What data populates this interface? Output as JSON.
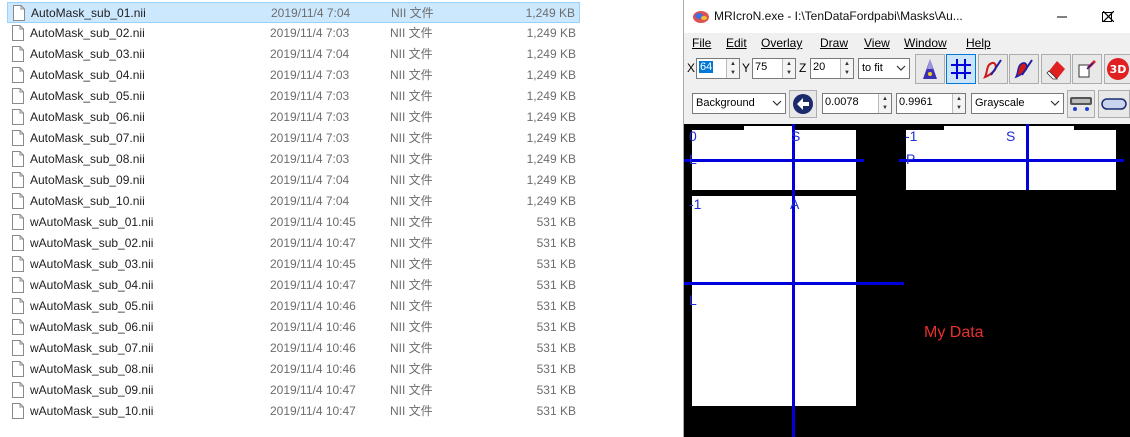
{
  "explorer": {
    "files": [
      {
        "name": "AutoMask_sub_01.nii",
        "date": "2019/11/4 7:04",
        "type": "NII 文件",
        "size": "1,249 KB",
        "selected": true
      },
      {
        "name": "AutoMask_sub_02.nii",
        "date": "2019/11/4 7:03",
        "type": "NII 文件",
        "size": "1,249 KB"
      },
      {
        "name": "AutoMask_sub_03.nii",
        "date": "2019/11/4 7:04",
        "type": "NII 文件",
        "size": "1,249 KB"
      },
      {
        "name": "AutoMask_sub_04.nii",
        "date": "2019/11/4 7:03",
        "type": "NII 文件",
        "size": "1,249 KB"
      },
      {
        "name": "AutoMask_sub_05.nii",
        "date": "2019/11/4 7:03",
        "type": "NII 文件",
        "size": "1,249 KB"
      },
      {
        "name": "AutoMask_sub_06.nii",
        "date": "2019/11/4 7:03",
        "type": "NII 文件",
        "size": "1,249 KB"
      },
      {
        "name": "AutoMask_sub_07.nii",
        "date": "2019/11/4 7:03",
        "type": "NII 文件",
        "size": "1,249 KB"
      },
      {
        "name": "AutoMask_sub_08.nii",
        "date": "2019/11/4 7:03",
        "type": "NII 文件",
        "size": "1,249 KB"
      },
      {
        "name": "AutoMask_sub_09.nii",
        "date": "2019/11/4 7:04",
        "type": "NII 文件",
        "size": "1,249 KB"
      },
      {
        "name": "AutoMask_sub_10.nii",
        "date": "2019/11/4 7:04",
        "type": "NII 文件",
        "size": "1,249 KB"
      },
      {
        "name": "wAutoMask_sub_01.nii",
        "date": "2019/11/4 10:45",
        "type": "NII 文件",
        "size": "531 KB"
      },
      {
        "name": "wAutoMask_sub_02.nii",
        "date": "2019/11/4 10:47",
        "type": "NII 文件",
        "size": "531 KB"
      },
      {
        "name": "wAutoMask_sub_03.nii",
        "date": "2019/11/4 10:45",
        "type": "NII 文件",
        "size": "531 KB"
      },
      {
        "name": "wAutoMask_sub_04.nii",
        "date": "2019/11/4 10:47",
        "type": "NII 文件",
        "size": "531 KB"
      },
      {
        "name": "wAutoMask_sub_05.nii",
        "date": "2019/11/4 10:46",
        "type": "NII 文件",
        "size": "531 KB"
      },
      {
        "name": "wAutoMask_sub_06.nii",
        "date": "2019/11/4 10:46",
        "type": "NII 文件",
        "size": "531 KB"
      },
      {
        "name": "wAutoMask_sub_07.nii",
        "date": "2019/11/4 10:46",
        "type": "NII 文件",
        "size": "531 KB"
      },
      {
        "name": "wAutoMask_sub_08.nii",
        "date": "2019/11/4 10:46",
        "type": "NII 文件",
        "size": "531 KB"
      },
      {
        "name": "wAutoMask_sub_09.nii",
        "date": "2019/11/4 10:47",
        "type": "NII 文件",
        "size": "531 KB"
      },
      {
        "name": "wAutoMask_sub_10.nii",
        "date": "2019/11/4 10:47",
        "type": "NII 文件",
        "size": "531 KB"
      }
    ]
  },
  "mricron": {
    "title": "MRIcroN.exe - I:\\TenDataFordpabi\\Masks\\Au...",
    "menu": {
      "file": "File",
      "edit": "Edit",
      "overlay": "Overlay",
      "draw": "Draw",
      "view": "View",
      "window": "Window",
      "help": "Help"
    },
    "coords": {
      "x_label": "X",
      "x_value": "64",
      "y_label": "Y",
      "y_value": "75",
      "z_label": "Z",
      "z_value": "20",
      "zoom": "to fit"
    },
    "layer": {
      "selected": "Background",
      "min": "0.0078",
      "max": "0.9961",
      "colormap": "Grayscale"
    },
    "toolbar_icons": [
      "triangle-pen-icon",
      "crosshair-icon",
      "pen-red-icon",
      "pen-blue-icon",
      "eraser-icon",
      "fill-icon",
      "3d-render-icon"
    ],
    "render_3d_label": "3D",
    "viewer": {
      "coronal": {
        "top": "S",
        "left": "0",
        "side": "L"
      },
      "sagittal": {
        "top": "S",
        "left": "-1",
        "side": "P"
      },
      "axial": {
        "top": "A",
        "left": "-1",
        "side": "L"
      },
      "annotation": "My Data"
    },
    "colors": {
      "crosshair": "#0000dd",
      "annotation": "#e8302e",
      "label": "#1f2fd8"
    }
  }
}
